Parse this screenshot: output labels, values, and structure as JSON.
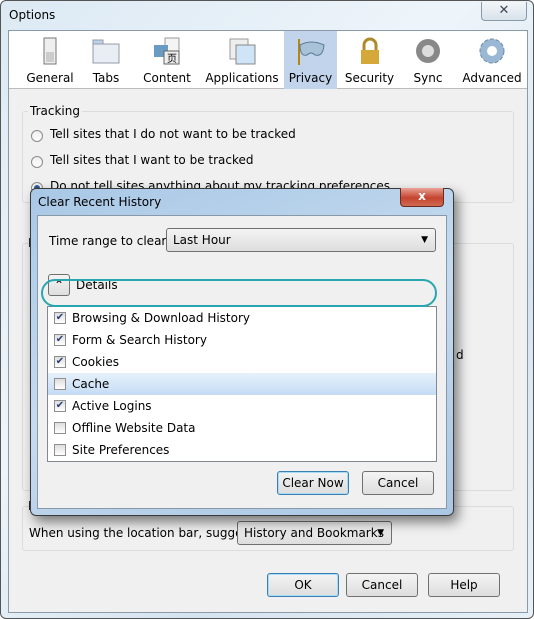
{
  "window": {
    "title": "Options",
    "close_icon": "close-icon"
  },
  "toolbar": {
    "items": [
      {
        "label": "General",
        "icon": "general-switch-icon"
      },
      {
        "label": "Tabs",
        "icon": "tabs-folder-icon"
      },
      {
        "label": "Content",
        "icon": "content-icon"
      },
      {
        "label": "Applications",
        "icon": "applications-icon"
      },
      {
        "label": "Privacy",
        "icon": "privacy-mask-icon",
        "selected": true
      },
      {
        "label": "Security",
        "icon": "security-lock-icon"
      },
      {
        "label": "Sync",
        "icon": "sync-icon"
      },
      {
        "label": "Advanced",
        "icon": "advanced-gear-icon"
      }
    ]
  },
  "tracking": {
    "title": "Tracking",
    "options": [
      "Tell sites that I do not want to be tracked",
      "Tell sites that I want to be tracked",
      "Do not tell sites anything about my tracking preferences"
    ],
    "selected": 2
  },
  "history_partial": {
    "title": "H",
    "fragment": "d"
  },
  "location_bar": {
    "title": "L",
    "label": "When using the location bar, suggest:",
    "value": "History and Bookmarks"
  },
  "footer": {
    "ok": "OK",
    "cancel": "Cancel",
    "help": "Help"
  },
  "dialog": {
    "title": "Clear Recent History",
    "close": "x",
    "time_range_label": "Time range to clear:",
    "time_range_value": "Last Hour",
    "details_label": "Details",
    "items": [
      {
        "label": "Browsing & Download History",
        "checked": true
      },
      {
        "label": "Form & Search History",
        "checked": true
      },
      {
        "label": "Cookies",
        "checked": true
      },
      {
        "label": "Cache",
        "checked": false,
        "highlighted": true
      },
      {
        "label": "Active Logins",
        "checked": true
      },
      {
        "label": "Offline Website Data",
        "checked": false
      },
      {
        "label": "Site Preferences",
        "checked": false
      }
    ],
    "clear_now": "Clear Now",
    "cancel": "Cancel",
    "highlight_color": "#2aa6b0"
  }
}
